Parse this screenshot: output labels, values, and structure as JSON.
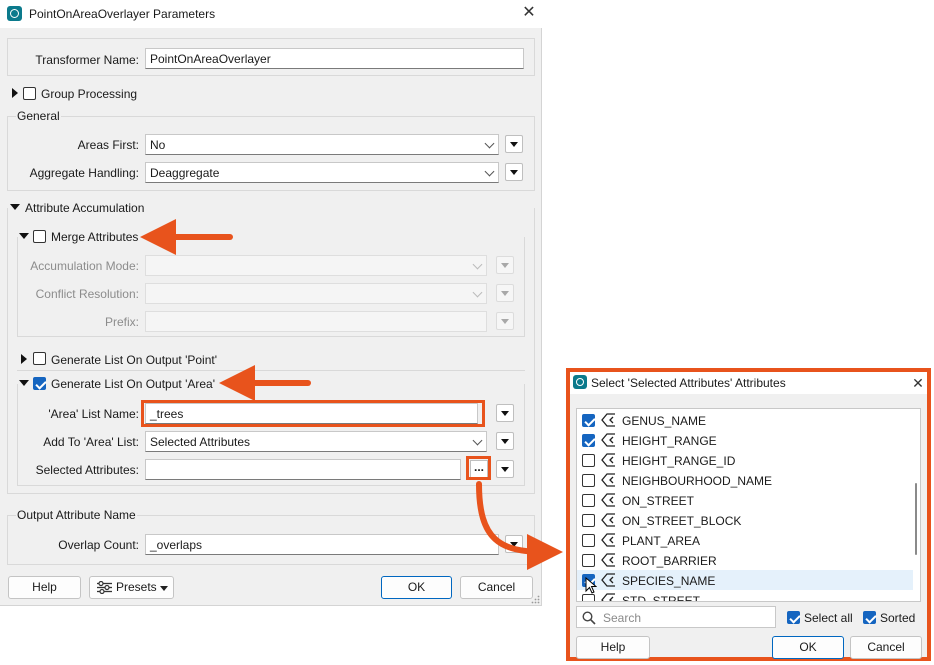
{
  "main_dialog": {
    "title": "PointOnAreaOverlayer Parameters",
    "transformer_name_label": "Transformer Name:",
    "transformer_name_value": "PointOnAreaOverlayer",
    "group_processing_label": "Group Processing",
    "general_label": "General",
    "areas_first_label": "Areas First:",
    "areas_first_value": "No",
    "aggregate_handling_label": "Aggregate Handling:",
    "aggregate_handling_value": "Deaggregate",
    "attribute_accumulation_label": "Attribute Accumulation",
    "merge_attributes_label": "Merge Attributes",
    "accumulation_mode_label": "Accumulation Mode:",
    "conflict_resolution_label": "Conflict Resolution:",
    "prefix_label": "Prefix:",
    "gen_list_point_label": "Generate List On Output 'Point'",
    "gen_list_area_label": "Generate List On Output 'Area'",
    "area_list_name_label": "'Area' List Name:",
    "area_list_name_value": "_trees",
    "add_to_area_list_label": "Add To 'Area' List:",
    "add_to_area_list_value": "Selected Attributes",
    "selected_attributes_label": "Selected Attributes:",
    "ellipsis_label": "...",
    "output_attribute_name_label": "Output Attribute Name",
    "overlap_count_label": "Overlap Count:",
    "overlap_count_value": "_overlaps",
    "help_label": "Help",
    "presets_label": "Presets",
    "ok_label": "OK",
    "cancel_label": "Cancel"
  },
  "select_dialog": {
    "title": "Select 'Selected Attributes' Attributes",
    "attributes": [
      {
        "name": "GENUS_NAME",
        "checked": true
      },
      {
        "name": "HEIGHT_RANGE",
        "checked": true
      },
      {
        "name": "HEIGHT_RANGE_ID",
        "checked": false
      },
      {
        "name": "NEIGHBOURHOOD_NAME",
        "checked": false
      },
      {
        "name": "ON_STREET",
        "checked": false
      },
      {
        "name": "ON_STREET_BLOCK",
        "checked": false
      },
      {
        "name": "PLANT_AREA",
        "checked": false
      },
      {
        "name": "ROOT_BARRIER",
        "checked": false
      },
      {
        "name": "SPECIES_NAME",
        "checked": true
      },
      {
        "name": "STD_STREET",
        "checked": false
      }
    ],
    "search_placeholder": "Search",
    "select_all_label": "Select all",
    "sorted_label": "Sorted",
    "help_label": "Help",
    "ok_label": "OK",
    "cancel_label": "Cancel"
  },
  "colors": {
    "annotation": "#e8531c",
    "accent": "#1565c0"
  }
}
